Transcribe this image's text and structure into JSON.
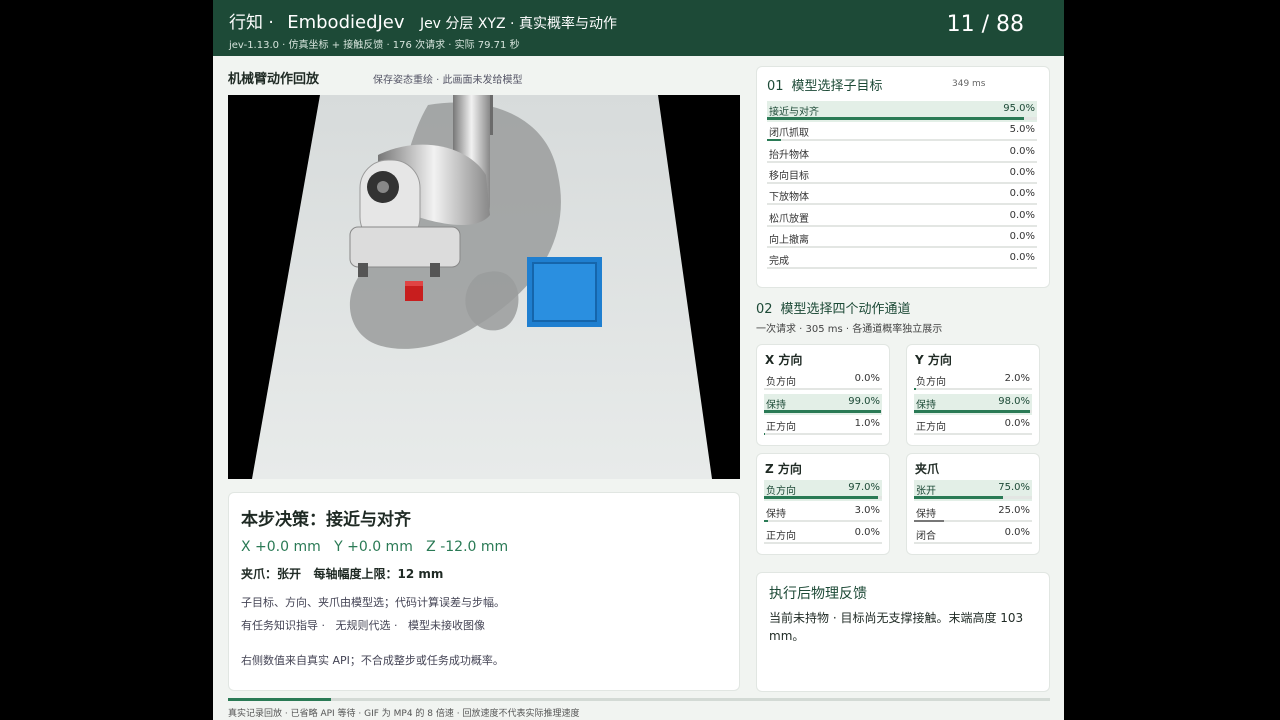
{
  "header": {
    "prefix": "行知 ·",
    "brand": "EmbodiedJev",
    "subtitle": "Jev 分层 XYZ ·  真实概率与动作",
    "meta": "jev-1.13.0 ·  仿真坐标 + 接触反馈 ·  176 次请求 ·  实际 79.71 秒",
    "counter": "11 / 88"
  },
  "viewer": {
    "title": "机械臂动作回放",
    "note": "保存姿态重绘 ·  此画面未发给模型"
  },
  "decision": {
    "heading": "本步决策：接近与对齐",
    "xyz": "X +0.0 mm   Y +0.0 mm   Z -12.0 mm",
    "gripper": "夹爪：张开   每轴幅度上限：12 mm",
    "note1": "子目标、方向、夹爪由模型选；代码计算误差与步幅。",
    "note2": "有任务知识指导 ·   无规则代选 ·   模型未接收图像",
    "note3": "右侧数值来自真实 API；不合成整步或任务成功概率。"
  },
  "subgoals": {
    "num": "01",
    "title": "模型选择子目标",
    "latency": "349 ms",
    "items": [
      {
        "label": "接近与对齐",
        "value": "95.0%",
        "p": 0.95,
        "selected": true
      },
      {
        "label": "闭爪抓取",
        "value": "5.0%",
        "p": 0.05
      },
      {
        "label": "抬升物体",
        "value": "0.0%",
        "p": 0.0
      },
      {
        "label": "移向目标",
        "value": "0.0%",
        "p": 0.0
      },
      {
        "label": "下放物体",
        "value": "0.0%",
        "p": 0.0
      },
      {
        "label": "松爪放置",
        "value": "0.0%",
        "p": 0.0
      },
      {
        "label": "向上撤离",
        "value": "0.0%",
        "p": 0.0
      },
      {
        "label": "完成",
        "value": "0.0%",
        "p": 0.0
      }
    ]
  },
  "channels": {
    "num": "02",
    "title": "模型选择四个动作通道",
    "subtitle": "一次请求 ·   305 ms ·   各通道概率独立展示",
    "x": {
      "title": "X 方向",
      "items": [
        {
          "label": "负方向",
          "value": "0.0%",
          "p": 0.0
        },
        {
          "label": "保持",
          "value": "99.0%",
          "p": 0.99,
          "selected": true
        },
        {
          "label": "正方向",
          "value": "1.0%",
          "p": 0.01
        }
      ]
    },
    "y": {
      "title": "Y 方向",
      "items": [
        {
          "label": "负方向",
          "value": "2.0%",
          "p": 0.02
        },
        {
          "label": "保持",
          "value": "98.0%",
          "p": 0.98,
          "selected": true
        },
        {
          "label": "正方向",
          "value": "0.0%",
          "p": 0.0
        }
      ]
    },
    "z": {
      "title": "Z 方向",
      "items": [
        {
          "label": "负方向",
          "value": "97.0%",
          "p": 0.97,
          "selected": true
        },
        {
          "label": "保持",
          "value": "3.0%",
          "p": 0.03
        },
        {
          "label": "正方向",
          "value": "0.0%",
          "p": 0.0
        }
      ]
    },
    "g": {
      "title": "夹爪",
      "items": [
        {
          "label": "张开",
          "value": "75.0%",
          "p": 0.75,
          "selected": true
        },
        {
          "label": "保持",
          "value": "25.0%",
          "p": 0.25,
          "gray": true
        },
        {
          "label": "闭合",
          "value": "0.0%",
          "p": 0.0
        }
      ]
    }
  },
  "feedback": {
    "title": "执行后物理反馈",
    "text": "当前未持物 ·   目标尚无支撑接触。末端高度 103 mm。"
  },
  "footer": {
    "progress": 0.125,
    "text": "真实记录回放 ·   已省略 API 等待 ·   GIF 为 MP4 的 8 倍速 ·   回放速度不代表实际推理速度"
  },
  "colors": {
    "header": "#1d4a37",
    "accent": "#2a7a55",
    "target_tray": "#1f7fd0",
    "cube": "#c81e1e"
  }
}
